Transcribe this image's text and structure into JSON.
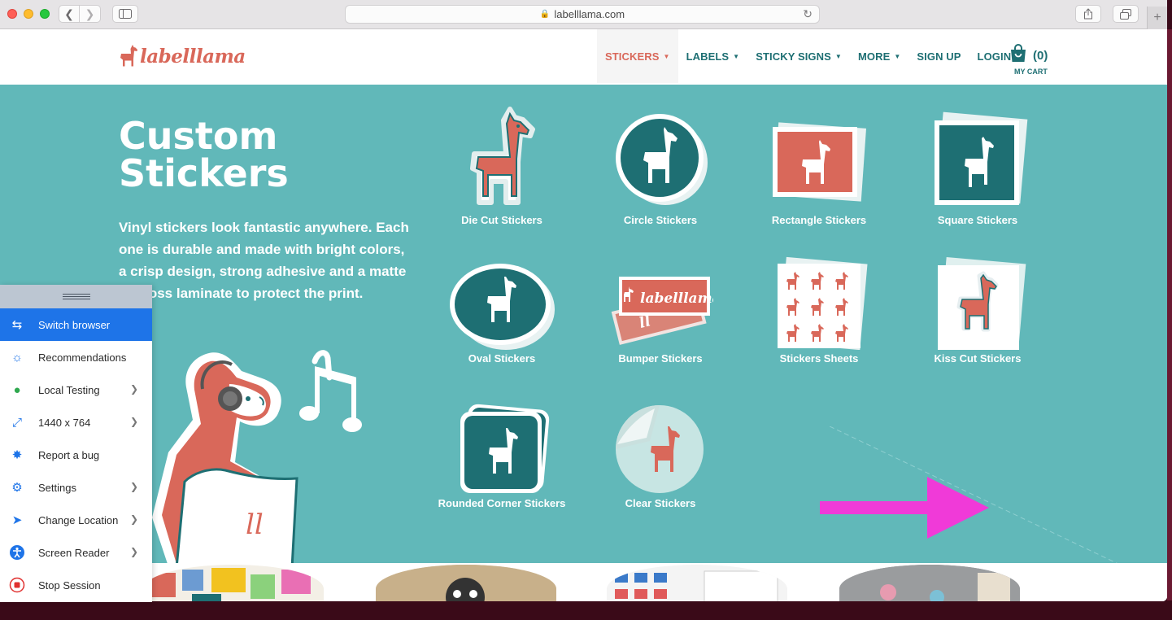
{
  "browser": {
    "url": "labelllama.com",
    "tab_plus": "+"
  },
  "site": {
    "logo_text": "labelllama",
    "nav": [
      {
        "label": "STICKERS",
        "caret": true
      },
      {
        "label": "LABELS",
        "caret": true
      },
      {
        "label": "STICKY SIGNS",
        "caret": true
      },
      {
        "label": "MORE",
        "caret": true
      },
      {
        "label": "SIGN UP",
        "caret": false
      },
      {
        "label": "LOGIN",
        "caret": false
      }
    ],
    "cart_count": "(0)",
    "cart_label": "MY CART"
  },
  "hero": {
    "title": "Custom Stickers",
    "description": "Vinyl stickers look fantastic anywhere. Each one is durable and made with bright colors, a crisp design, strong adhesive and a matte or gloss laminate to protect the print.",
    "products": [
      {
        "label": "Die Cut Stickers",
        "icon": "die-cut-sticker-icon"
      },
      {
        "label": "Circle Stickers",
        "icon": "circle-sticker-icon"
      },
      {
        "label": "Rectangle Stickers",
        "icon": "rectangle-sticker-icon"
      },
      {
        "label": "Square Stickers",
        "icon": "square-sticker-icon"
      },
      {
        "label": "Oval Stickers",
        "icon": "oval-sticker-icon"
      },
      {
        "label": "Bumper Stickers",
        "icon": "bumper-sticker-icon"
      },
      {
        "label": "Stickers Sheets",
        "icon": "sticker-sheet-icon"
      },
      {
        "label": "Kiss Cut Stickers",
        "icon": "kiss-cut-sticker-icon"
      },
      {
        "label": "Rounded Corner Stickers",
        "icon": "rounded-corner-sticker-icon"
      },
      {
        "label": "Clear Stickers",
        "icon": "clear-sticker-icon"
      }
    ],
    "bumper_text": "labelllama",
    "apron_text": "ll"
  },
  "colors": {
    "teal": "#61b8b9",
    "dark_teal": "#1e6f73",
    "coral": "#d9685a",
    "accent_blue": "#1e74e8",
    "magenta_arrow": "#f03ad8"
  },
  "tool_panel": {
    "items": [
      {
        "label": "Switch browser",
        "icon": "switch-arrows-icon",
        "chevron": false,
        "active": true
      },
      {
        "label": "Recommendations",
        "icon": "lightbulb-icon",
        "chevron": false,
        "active": false
      },
      {
        "label": "Local Testing",
        "icon": "local-testing-icon",
        "chevron": true,
        "active": false
      },
      {
        "label": "1440 x 764",
        "icon": "resize-icon",
        "chevron": true,
        "active": false
      },
      {
        "label": "Report a bug",
        "icon": "bug-icon",
        "chevron": false,
        "active": false
      },
      {
        "label": "Settings",
        "icon": "gear-icon",
        "chevron": true,
        "active": false
      },
      {
        "label": "Change Location",
        "icon": "location-arrow-icon",
        "chevron": true,
        "active": false
      },
      {
        "label": "Screen Reader",
        "icon": "accessibility-icon",
        "chevron": true,
        "active": false
      },
      {
        "label": "Stop Session",
        "icon": "stop-icon",
        "chevron": false,
        "active": false
      }
    ]
  }
}
